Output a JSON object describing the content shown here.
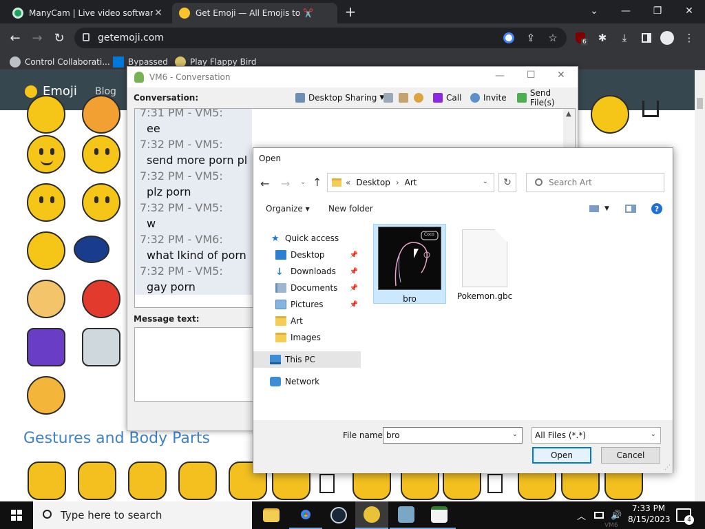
{
  "browser": {
    "tabs": [
      {
        "title": "ManyCam | Live video software &",
        "active": false
      },
      {
        "title": "Get Emoji — All Emojis to ✂️",
        "active": true
      }
    ],
    "new_tab": "+",
    "window_controls": {
      "minimize": "—",
      "restore": "❐",
      "close": "✕",
      "tab_search": "⌄"
    },
    "nav": {
      "back": "←",
      "forward": "→",
      "reload": "↻"
    },
    "url": "getemoji.com",
    "extension_badge": "6",
    "bookmarks": [
      {
        "label": "Control Collaborati..."
      },
      {
        "label": "Bypassed"
      },
      {
        "label": "Play Flappy Bird"
      }
    ]
  },
  "site": {
    "logo": "Emoji",
    "nav_blog": "Blog",
    "section_heading": "Gestures and Body Parts"
  },
  "vm6": {
    "title": "VM6 - Conversation",
    "conversation_label": "Conversation:",
    "toolbar": {
      "desktop_sharing": "Desktop Sharing",
      "call": "Call",
      "invite": "Invite",
      "send_files": "Send File(s)"
    },
    "chat": [
      {
        "time": "7:31 PM - VM5:",
        "msg": "ee"
      },
      {
        "time": "7:32 PM - VM5:",
        "msg": "send more porn pl"
      },
      {
        "time": "7:32 PM - VM5:",
        "msg": "plz porn"
      },
      {
        "time": "7:32 PM - VM5:",
        "msg": "w"
      },
      {
        "time": "7:32 PM - VM6:",
        "msg": "what lkind of porn"
      },
      {
        "time": "7:32 PM - VM5:",
        "msg": "gay porn"
      }
    ],
    "message_label": "Message text:"
  },
  "open_dialog": {
    "title": "Open",
    "breadcrumb": [
      "«",
      "Desktop",
      "›",
      "Art"
    ],
    "search_placeholder": "Search Art",
    "organize": "Organize ▾",
    "new_folder": "New folder",
    "nav": [
      {
        "label": "Quick access",
        "pinned": false
      },
      {
        "label": "Desktop",
        "pinned": true
      },
      {
        "label": "Downloads",
        "pinned": true
      },
      {
        "label": "Documents",
        "pinned": true
      },
      {
        "label": "Pictures",
        "pinned": true
      },
      {
        "label": "Art",
        "pinned": false
      },
      {
        "label": "Images",
        "pinned": false
      },
      {
        "label": "This PC",
        "pinned": false
      },
      {
        "label": "Network",
        "pinned": false
      }
    ],
    "files": [
      {
        "name": "bro",
        "selected": true,
        "thumb_label": "Coco"
      },
      {
        "name": "Pokemon.gbc",
        "selected": false
      }
    ],
    "file_name_label": "File name:",
    "file_name_value": "bro",
    "file_type_value": "All Files (*.*)",
    "open_button": "Open",
    "cancel_button": "Cancel"
  },
  "taskbar": {
    "search_placeholder": "Type here to search",
    "time": "7:33 PM",
    "date": "8/15/2023",
    "notification_count": "4",
    "peek_label": "VM6"
  },
  "colors": {
    "chrome_dark": "#202124",
    "chrome_toolbar": "#35363a",
    "site_header": "#37474f",
    "accent_blue": "#0078d7",
    "emoji_yellow": "#f5c518",
    "gesture_heading": "#3f82c6"
  }
}
